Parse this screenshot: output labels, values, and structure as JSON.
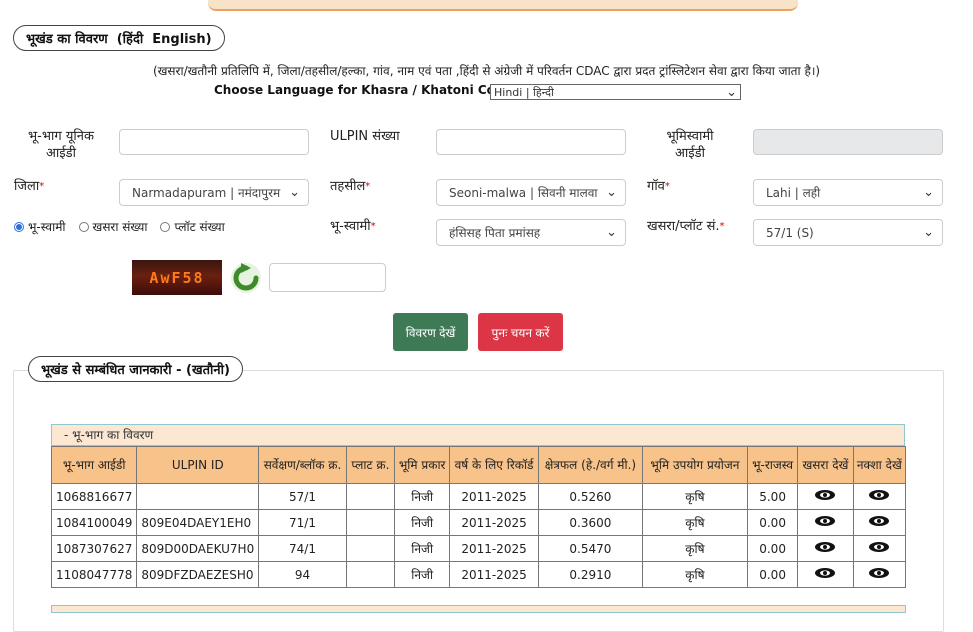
{
  "section1": {
    "title": "भूखंड का विवरण",
    "lang_hi": "हिंदी",
    "lang_en": "English"
  },
  "note": "(खसरा/खतौनी प्रतिलिपि में, जिला/तहसील/हल्का, गांव, नाम एवं पता ,हिंदी से अंग्रेजी में परिवर्तन CDAC द्वारा प्रदत ट्रांस्लिटेशन सेवा द्वारा किया जाता है।)",
  "language": {
    "label": "Choose Language for Khasra / Khatoni Copy:",
    "selected": "Hindi | हिन्दी"
  },
  "form": {
    "bhubhag_label": "भू-भाग  यूनिक\nआईडी",
    "ulpin_label": "ULPIN संख्या",
    "bhumiswami_id_label": "भूमिस्वामी\nआईडी",
    "jila_label": "जिला",
    "jila_value": "Narmadapuram | नमंदापुरम",
    "tehsil_label": "तहसील",
    "tehsil_value": "Seoni-malwa | सिवनी मालवा",
    "gaon_label": "गॉव",
    "gaon_value": "Lahi | लही",
    "bhuswami_label": "भू-स्वामी",
    "bhuswami_value": "हंसिसह पिता प्रमांसह",
    "khasra_label": "खसरा/प्लॉट सं.",
    "khasra_value": "57/1 (S)",
    "required_mark": "*"
  },
  "radios": [
    {
      "label": "भू-स्वामी",
      "checked": true
    },
    {
      "label": "खसरा संख्या",
      "checked": false
    },
    {
      "label": "प्लॉट संख्या",
      "checked": false
    }
  ],
  "captcha": {
    "text": "AwF58"
  },
  "buttons": {
    "submit": "विवरण देखें",
    "reset": "पुनः चयन करें"
  },
  "section2": {
    "title": "भूखंड से सम्बंधित जानकारी -  (खतौनी)"
  },
  "table": {
    "caption": "- भू-भाग का विवरण",
    "headers": [
      "भू-भाग आईडी",
      "ULPIN ID",
      "सर्वेक्षण/ब्लॉक क्र.",
      "प्लाट क्र.",
      "भूमि प्रकार",
      "वर्ष के लिए रिकॉर्ड",
      "क्षेत्रफल (हे./वर्ग मी.)",
      "भूमि उपयोग प्रयोजन",
      "भू-राजस्व",
      "खसरा देखें",
      "नक्शा देखें"
    ],
    "rows": [
      [
        "1068816677",
        "",
        "57/1",
        "",
        "निजी",
        "2011-2025",
        "0.5260",
        "कृषि",
        "5.00"
      ],
      [
        "1084100049",
        "809E04DAEY1EH0",
        "71/1",
        "",
        "निजी",
        "2011-2025",
        "0.3600",
        "कृषि",
        "0.00"
      ],
      [
        "1087307627",
        "809D00DAEKU7H0",
        "74/1",
        "",
        "निजी",
        "2011-2025",
        "0.5470",
        "कृषि",
        "0.00"
      ],
      [
        "1108047778",
        "809DFZDAEZESH0",
        "94",
        "",
        "निजी",
        "2011-2025",
        "0.2910",
        "कृषि",
        "0.00"
      ]
    ]
  }
}
